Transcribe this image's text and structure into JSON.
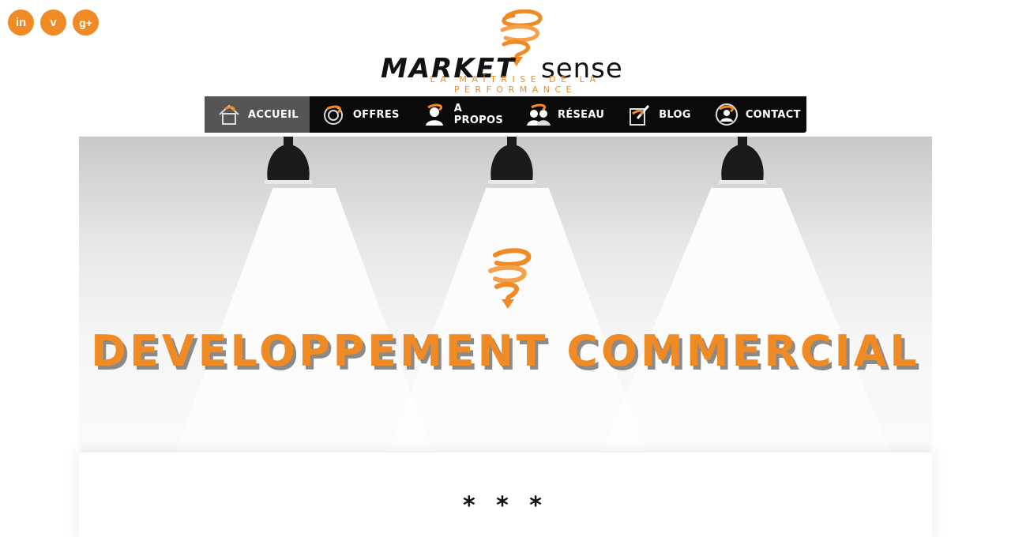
{
  "social": {
    "linkedin_glyph": "in",
    "viadeo_glyph": "v",
    "googleplus_glyph": "g+"
  },
  "logo": {
    "word_left": "MARKET",
    "word_right": "sense",
    "tagline": "LA MAÎTRISE DE LA PERFORMANCE"
  },
  "nav": {
    "items": [
      {
        "label": "ACCUEIL",
        "icon": "home-icon",
        "active": true
      },
      {
        "label": "OFFRES",
        "icon": "target-icon",
        "active": false
      },
      {
        "label": "A PROPOS",
        "icon": "person-icon",
        "active": false
      },
      {
        "label": "RÉSEAU",
        "icon": "network-icon",
        "active": false
      },
      {
        "label": "BLOG",
        "icon": "blog-icon",
        "active": false
      },
      {
        "label": "CONTACT",
        "icon": "contact-icon",
        "active": false
      }
    ]
  },
  "hero": {
    "title": "DEVELOPPEMENT COMMERCIAL"
  },
  "content": {
    "separator": "* * *"
  },
  "colors": {
    "accent": "#f08a24",
    "nav_bg": "#0a0a0a",
    "nav_active": "#555555"
  }
}
